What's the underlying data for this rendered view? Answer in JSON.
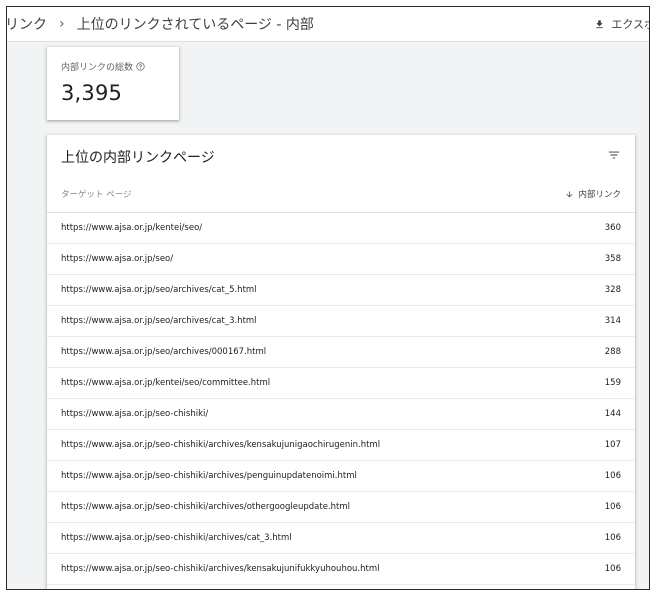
{
  "header": {
    "crumb_parent": "リンク",
    "crumb_sep": "›",
    "crumb_current": "上位のリンクされているページ - 内部",
    "export_label": "エクスポ"
  },
  "summary": {
    "label": "内部リンクの総数",
    "value": "3,395"
  },
  "table": {
    "title": "上位の内部リンクページ",
    "col_page": "ターゲット ページ",
    "col_links": "内部リンク",
    "rows": [
      {
        "url": "https://www.ajsa.or.jp/kentei/seo/",
        "count": "360"
      },
      {
        "url": "https://www.ajsa.or.jp/seo/",
        "count": "358"
      },
      {
        "url": "https://www.ajsa.or.jp/seo/archives/cat_5.html",
        "count": "328"
      },
      {
        "url": "https://www.ajsa.or.jp/seo/archives/cat_3.html",
        "count": "314"
      },
      {
        "url": "https://www.ajsa.or.jp/seo/archives/000167.html",
        "count": "288"
      },
      {
        "url": "https://www.ajsa.or.jp/kentei/seo/committee.html",
        "count": "159"
      },
      {
        "url": "https://www.ajsa.or.jp/seo-chishiki/",
        "count": "144"
      },
      {
        "url": "https://www.ajsa.or.jp/seo-chishiki/archives/kensakujunigaochirugenin.html",
        "count": "107"
      },
      {
        "url": "https://www.ajsa.or.jp/seo-chishiki/archives/penguinupdatenoimi.html",
        "count": "106"
      },
      {
        "url": "https://www.ajsa.or.jp/seo-chishiki/archives/othergoogleupdate.html",
        "count": "106"
      },
      {
        "url": "https://www.ajsa.or.jp/seo-chishiki/archives/cat_3.html",
        "count": "106"
      },
      {
        "url": "https://www.ajsa.or.jp/seo-chishiki/archives/kensakujunifukkyuhouhou.html",
        "count": "106"
      }
    ]
  },
  "icons": {
    "export": "download-icon",
    "help": "help-circle-icon",
    "filter": "filter-icon",
    "sort": "arrow-down-icon"
  }
}
